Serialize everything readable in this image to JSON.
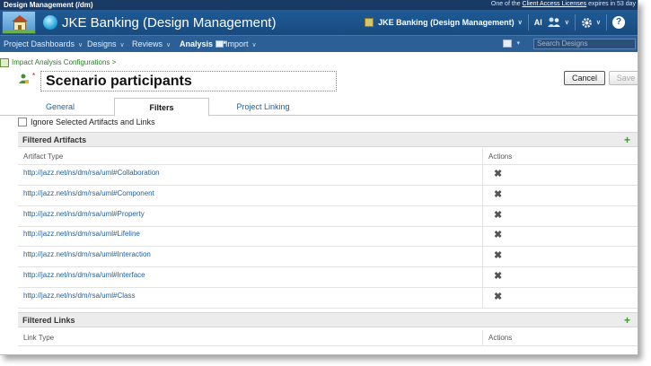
{
  "topbar": {
    "app_title": "Design Management (/dm)",
    "license_prefix": "One of the",
    "license_link": "Client Access Licenses",
    "license_suffix": "expires in 53 day"
  },
  "header": {
    "project_title": "JKE Banking (Design Management)",
    "project_switcher": "JKE Banking (Design Management)",
    "user_initials": "Al"
  },
  "nav": {
    "items": [
      {
        "label": "Project Dashboards"
      },
      {
        "label": "Designs"
      },
      {
        "label": "Reviews"
      },
      {
        "label": "Analysis"
      },
      {
        "label": "Import"
      }
    ],
    "analysis_marker": "*",
    "search_placeholder": "Search Designs"
  },
  "page": {
    "breadcrumb": "Impact Analysis Configurations >",
    "required_marker": "*",
    "title": "Scenario participants",
    "cancel_label": "Cancel",
    "save_label": "Save"
  },
  "tabs": [
    {
      "label": "General"
    },
    {
      "label": "Filters",
      "active": true
    },
    {
      "label": "Project Linking"
    }
  ],
  "ignore_checkbox_label": "Ignore Selected Artifacts and Links",
  "filtered_artifacts": {
    "title": "Filtered Artifacts",
    "columns": [
      "Artifact Type",
      "Actions"
    ],
    "rows": [
      "http://jazz.net/ns/dm/rsa/uml#Collaboration",
      "http://jazz.net/ns/dm/rsa/uml#Component",
      "http://jazz.net/ns/dm/rsa/uml#Property",
      "http://jazz.net/ns/dm/rsa/uml#Lifeline",
      "http://jazz.net/ns/dm/rsa/uml#Interaction",
      "http://jazz.net/ns/dm/rsa/uml#Interface",
      "http://jazz.net/ns/dm/rsa/uml#Class"
    ]
  },
  "filtered_links": {
    "title": "Filtered Links",
    "columns": [
      "Link Type",
      "Actions"
    ]
  },
  "icons": {
    "add": "plus-icon",
    "delete": "delete-x-icon",
    "help": "help-icon",
    "settings": "gear-icon",
    "users": "users-icon"
  },
  "colors": {
    "brand_header": "#1f5b96",
    "nav": "#2c5f96",
    "link": "#1f5f9e",
    "add_green": "#3a9a2a"
  }
}
